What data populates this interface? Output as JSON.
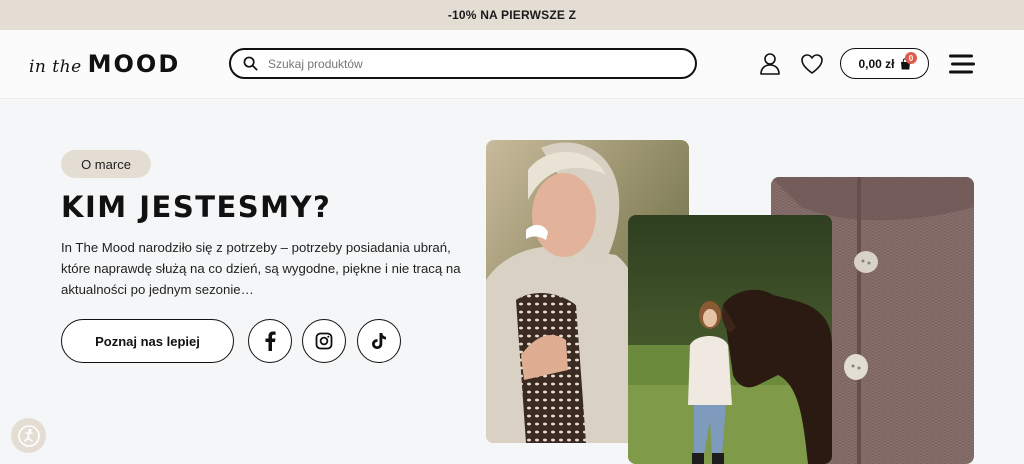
{
  "promo": {
    "text": "-10% NA PIERWSZE Z"
  },
  "header": {
    "logo_script": "in the",
    "logo_main": "MOOD",
    "search": {
      "placeholder": "Szukaj produktów",
      "icon": "search-icon"
    },
    "account_icon": "user-icon",
    "wishlist_icon": "heart-icon",
    "cart": {
      "total": "0,00 zł",
      "count": "0",
      "icon": "shopping-bag-icon"
    },
    "menu_icon": "hamburger-menu-icon"
  },
  "hero": {
    "tag": "O marce",
    "title": "KIM JESTESMY?",
    "description": "In The Mood narodziło się z potrzeby – potrzeby posiadania ubrań, które naprawdę służą na co dzień, są wygodne, piękne i nie tracą na aktualności po jednym sezonie…",
    "cta_label": "Poznaj nas lepiej",
    "socials": [
      "facebook-icon",
      "instagram-icon",
      "tiktok-icon"
    ]
  },
  "colors": {
    "accent_beige": "#e4ddd3",
    "text_dark": "#111111",
    "badge_red": "#e05c4b",
    "sweater_brown": "#7a6360"
  },
  "accessibility_icon": "accessibility-icon"
}
